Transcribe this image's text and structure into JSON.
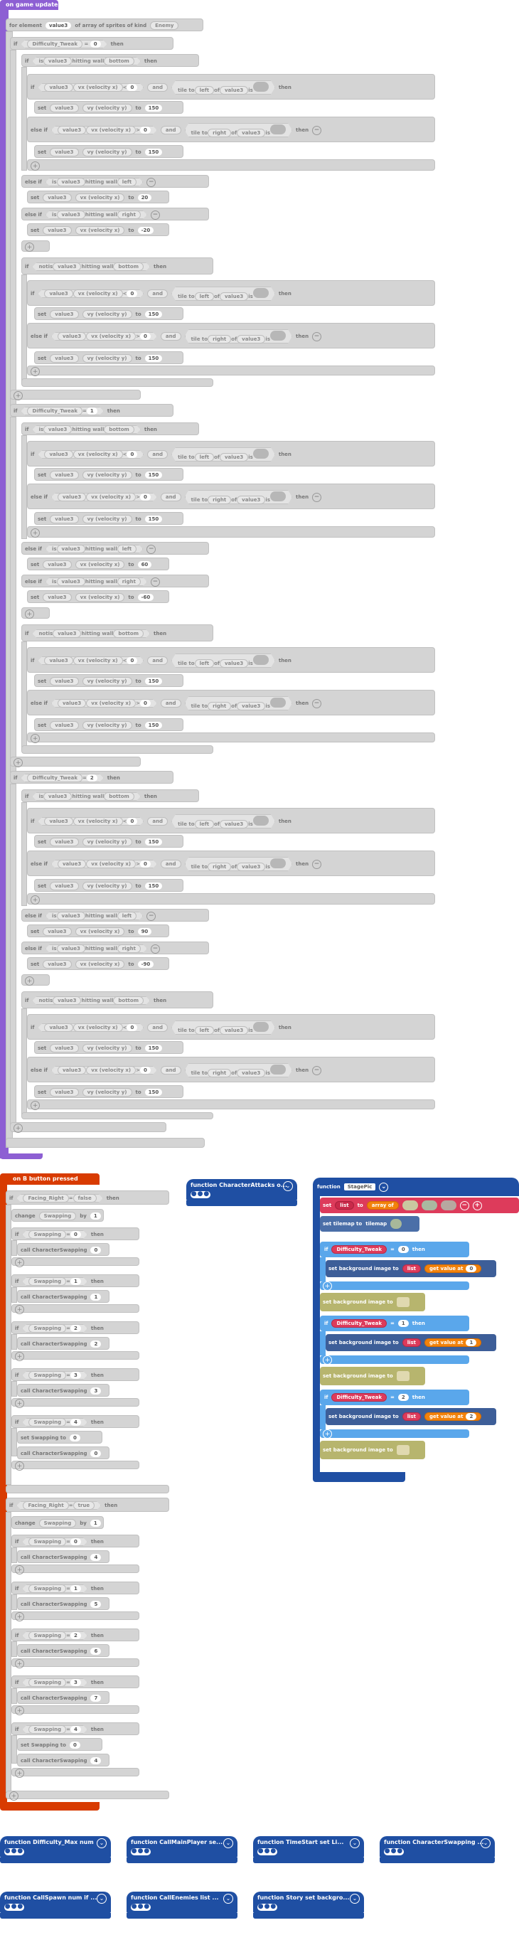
{
  "top_event": {
    "label": "on game update",
    "loop": {
      "for": "for element",
      "var": "value3",
      "of": "of array of sprites of kind",
      "kind": "Enemy"
    }
  },
  "tokens": {
    "if": "if",
    "then": "then",
    "else_if": "else if",
    "set": "set",
    "to": "to",
    "is": "is",
    "hitting_wall": "hitting wall",
    "bottom": "bottom",
    "left": "left",
    "right": "right",
    "not": "not",
    "and": "and",
    "tile_to": "tile to",
    "of": "of",
    "vx": "vx (velocity x)",
    "vy": "vy (velocity y)",
    "value3": "value3",
    "eq": "=",
    "difficulty": "Difficulty_Tweak",
    "lt": "<",
    "gt": ">"
  },
  "levels": [
    "0",
    "1",
    "2"
  ],
  "values": {
    "vy": "150",
    "zero": "0",
    "lvl0_left": "20",
    "lvl0_right": "-20",
    "lvl1_left": "60",
    "lvl1_right": "-60",
    "lvl2_left": "90",
    "lvl2_right": "-90"
  },
  "button_event": {
    "label": "on B button pressed",
    "facing": "Facing_Right",
    "value_false": "false",
    "value_true": "true",
    "change": "change",
    "swapping": "Swapping",
    "by": "by",
    "call_swap": "call CharacterSwapping",
    "set_swapping": "set Swapping to",
    "branch1_vals": [
      "0",
      "1",
      "2",
      "3",
      "4"
    ],
    "branch1_calls": [
      "0",
      "1",
      "2",
      "3",
      "0"
    ],
    "branch2_vals": [
      "0",
      "1",
      "2",
      "3",
      "4"
    ],
    "branch2_calls": [
      "4",
      "5",
      "6",
      "7",
      "4"
    ]
  },
  "stage_fn": {
    "function": "function",
    "name": "StagePic",
    "set_list": "set",
    "list": "list",
    "array_of": "array of",
    "set_tilemap": "set tilemap to",
    "tilemap": "tilemap",
    "set_bg": "set background image to",
    "get_value_at": "get value at",
    "diff": "Difficulty_Tweak",
    "idx": [
      "0",
      "1",
      "2"
    ]
  },
  "fn_cards": [
    "function CharacterAttacks o...",
    "function Difficulty_Max num",
    "function CallMainPlayer se...",
    "function TimeStart set Li...",
    "function CharacterSwapping ...",
    "function CallSpawn num if ...",
    "function CallEnemies list ...",
    "function Story set backgro..."
  ],
  "dots": "●●●",
  "colors": {
    "events": "#8d5fd3",
    "button": "#d83b01",
    "functions": "#1f4fa3",
    "logic": "#5aa7eb",
    "variables": "#dd3b5b",
    "disabled": "#d4d4d4"
  }
}
